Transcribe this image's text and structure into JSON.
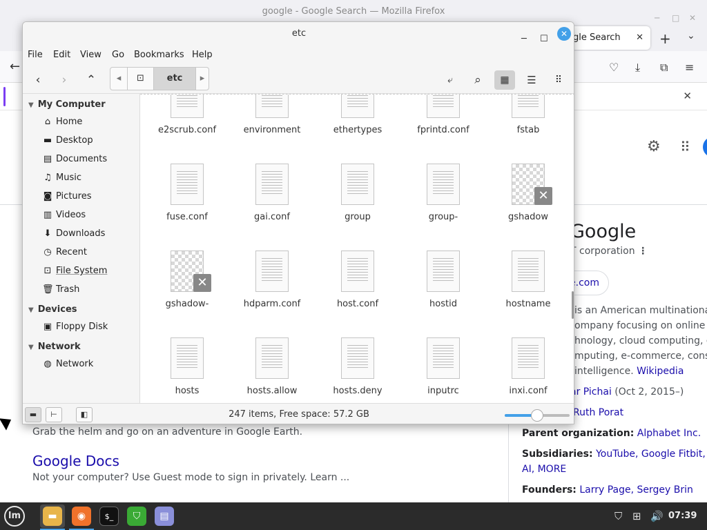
{
  "firefox": {
    "window_title": "google - Google Search — Mozilla Firefox",
    "tab_label": "gle Search",
    "google": {
      "knowledge_panel": {
        "title": "Google",
        "subtitle": "T corporation",
        "website_fragment": "e.com",
        "description_lines": [
          "is an American multinational co",
          "ompany focusing on online adv",
          "hnology, cloud computing, compu",
          "mputing, e-commerce, consume",
          "intelligence."
        ],
        "wikipedia": "Wikipedia",
        "ceo_fragment": "ar Pichai",
        "ceo_date": " (Oct 2, 2015–)",
        "cfo_fragment": "Ruth Porat",
        "parent_label": "Parent organization:",
        "parent_value": "Alphabet Inc.",
        "subsidiaries_label": "Subsidiaries:",
        "subsidiaries_value": "YouTube, Google Fitbit, Man",
        "subsidiaries_more": "AI, MORE",
        "founders_label": "Founders:",
        "founders_value": "Larry Page, Sergey Brin"
      },
      "results": {
        "earth_snippet": "Grab the helm and go on an adventure in Google Earth.",
        "docs_title": "Google Docs",
        "docs_snippet": "Not your computer? Use Guest mode to sign in privately. Learn ..."
      }
    }
  },
  "nemo": {
    "title": "etc",
    "menu": [
      "File",
      "Edit",
      "View",
      "Go",
      "Bookmarks",
      "Help"
    ],
    "path_current": "etc",
    "sidebar": {
      "my_computer": "My Computer",
      "places": [
        "Home",
        "Desktop",
        "Documents",
        "Music",
        "Pictures",
        "Videos",
        "Downloads",
        "Recent",
        "File System",
        "Trash"
      ],
      "devices": "Devices",
      "device_items": [
        "Floppy Disk"
      ],
      "network": "Network",
      "network_items": [
        "Network"
      ]
    },
    "files": {
      "row0": [
        "e2scrub.conf",
        "environment",
        "ethertypes",
        "fprintd.conf",
        "fstab"
      ],
      "row1": [
        "fuse.conf",
        "gai.conf",
        "group",
        "group-",
        "gshadow"
      ],
      "row2": [
        "gshadow-",
        "hdparm.conf",
        "host.conf",
        "hostid",
        "hostname"
      ],
      "row3": [
        "hosts",
        "hosts.allow",
        "hosts.deny",
        "inputrc",
        "inxi.conf"
      ]
    },
    "status": "247 items, Free space: 57.2 GB",
    "zoom_level": 0.5
  },
  "taskbar": {
    "clock": "07:39"
  },
  "colors": {
    "accent": "#43a0e8",
    "link": "#1a0dab",
    "taskbar": "#2b2b2b"
  }
}
